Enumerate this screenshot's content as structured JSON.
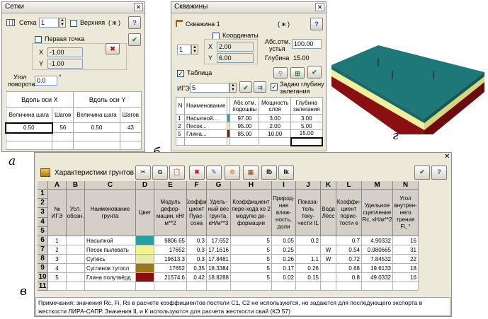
{
  "setki": {
    "title": "Сетки",
    "grid_label": "Сетка",
    "grid_value": "1",
    "upper_label": "Верхняя",
    "paren_label": "( ж )",
    "first_point_label": "Первая точка",
    "x_label": "X",
    "x_value": "-1.00",
    "y_label": "Y",
    "y_value": "-1.00",
    "angle_label_1": "Угол",
    "angle_label_2": "поворота",
    "angle_value": "0.0",
    "degree": "°",
    "axis_x_header": "Вдоль оси X",
    "axis_y_header": "Вдоль оси Y",
    "step_size_label": "Величина шага",
    "steps_label": "Шагов",
    "x_step": "0.50",
    "x_steps": "56",
    "y_step": "0.50",
    "y_steps": "43"
  },
  "skvazhiny": {
    "title": "Скважины",
    "well_label": "Скважина 1",
    "paren_label": "( ж )",
    "coords_label": "Координаты",
    "number": "1",
    "x_label": "X",
    "x_value": "2.00",
    "y_label": "Y",
    "y_value": "6.00",
    "abs_label_1": "Абс.отм.",
    "abs_label_2": "устья",
    "abs_value": "100.00",
    "depth_label": "Глубина",
    "depth_value": "15.00",
    "table_label": "Таблица",
    "ige_label": "ИГЭ",
    "ige_value": "5",
    "set_depth_label_1": "Задаю глубину",
    "set_depth_label_2": "залегания",
    "headers": [
      "N",
      "Наименование",
      "Абс.отм. подошвы",
      "Мощность слоя",
      "Глубина залегания"
    ],
    "rows": [
      {
        "n": "1",
        "name": "Насыпной...",
        "abs": "97.00",
        "thick": "3.00",
        "depth": "3.00",
        "color": "#1fa3a3"
      },
      {
        "n": "2",
        "name": "Песок...",
        "abs": "95.00",
        "thick": "2.00",
        "depth": "5.00",
        "color": "#f4f48c"
      },
      {
        "n": "5",
        "name": "Глина...",
        "abs": "85.00",
        "thick": "10.00",
        "depth": "15.00",
        "color": "#8b0e10"
      }
    ]
  },
  "captions": {
    "a": "а",
    "b": "б",
    "v": "в",
    "g": "г"
  },
  "soil": {
    "title": "Характеристики грунтов",
    "col_letters": [
      "A",
      "B",
      "C",
      "D",
      "E",
      "F",
      "G",
      "H",
      "I",
      "J",
      "K",
      "L",
      "M",
      "N"
    ],
    "headers": [
      "№ ИГЭ",
      "Усл. обозн.",
      "Наименование грунта",
      "Цвет",
      "Модуль дефор-мации, кН/м**2",
      "Коэффи-циент Пуас-сона",
      "Удель-ный вес грунта, кН/м**3",
      "Коэффициент пере-хода ко 2 модулю де-формации",
      "Природ-ная влаж-ность, доли",
      "Показа-тель теку-чести IL",
      "Вода Лёсс",
      "Коэффи-циент порис-тости е",
      "Удельное сцепление Rс, кН/м**2",
      "Угол внутрен-него трения Fi, °"
    ],
    "row_numbers": [
      "1",
      "2",
      "3",
      "4",
      "5",
      "6",
      "7",
      "8",
      "9",
      "10",
      "11"
    ],
    "rows": [
      {
        "ige": "1",
        "name": "Насыпной",
        "color": "#1fa3a3",
        "e": "9806.65",
        "nu": "0.3",
        "gamma": "17.652",
        "k2": "5",
        "w": "0.05",
        "il": "0.2",
        "water": "",
        "por": "0.7",
        "c": "4.90332",
        "fi": "16"
      },
      {
        "ige": "2",
        "name": "Песок пылевать",
        "color": "#f4f48c",
        "e": "17652",
        "nu": "0.3",
        "gamma": "17.1616",
        "k2": "5",
        "w": "0.25",
        "il": "",
        "water": "W",
        "por": "0.54",
        "c": "0.980665",
        "fi": "31"
      },
      {
        "ige": "3",
        "name": "Супесь",
        "color": "#e9e9a8",
        "e": "19613.3",
        "nu": "0.3",
        "gamma": "17.8481",
        "k2": "5",
        "w": "0.26",
        "il": "1.1",
        "water": "W",
        "por": "0.72",
        "c": "7.84532",
        "fi": "22"
      },
      {
        "ige": "4",
        "name": "Суглинок тугопл",
        "color": "#9a7a18",
        "e": "17652",
        "nu": "0.35",
        "gamma": "18.3384",
        "k2": "5",
        "w": "0.17",
        "il": "0.26",
        "water": "",
        "por": "0.68",
        "c": "19.6133",
        "fi": "18"
      },
      {
        "ige": "5",
        "name": "Глина полутвёрд",
        "color": "#8b0e10",
        "e": "21574.6",
        "nu": "0.42",
        "gamma": "18.8288",
        "k2": "5",
        "w": "0.02",
        "il": "0.15",
        "water": "",
        "por": "0.8",
        "c": "49.0332",
        "fi": "16"
      }
    ],
    "note": "Примечания: значения Rс, Fi, Rs в расчете коэффициентов постели С1, С2 не используются, но задаются для последующего экспорта в жесткости ЛИРА-САПР. Значения IL и К используются для расчета жесткости свай (КЭ 57)"
  },
  "colors": {
    "teal": "#1fa3a3",
    "sand": "#f4f48c",
    "clay": "#8b0e10"
  }
}
